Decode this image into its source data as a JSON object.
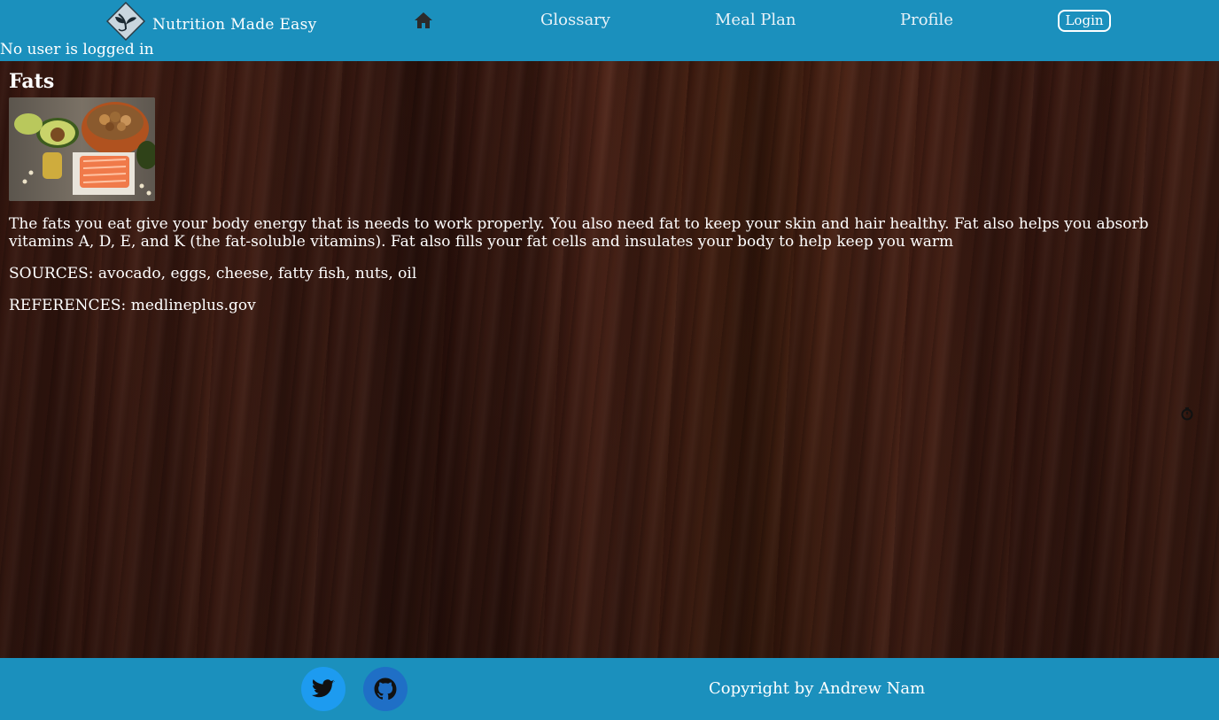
{
  "brand": {
    "name": "Nutrition Made Easy",
    "logo_icon": "leaf-diamond-logo"
  },
  "nav": {
    "home_icon": "home-icon",
    "glossary": "Glossary",
    "meal_plan": "Meal Plan",
    "profile": "Profile",
    "login": "Login"
  },
  "user_status": "No user is logged in",
  "article": {
    "title": "Fats",
    "image_subject": "fat-rich foods: avocado, salmon, nuts, oil",
    "description": "The fats you eat give your body energy that is needs to work properly. You also need fat to keep your skin and hair healthy. Fat also helps you absorb vitamins A, D, E, and K (the fat-soluble vitamins). Fat also fills your fat cells and insulates your body to help keep you warm",
    "sources": "SOURCES: avocado, eggs, cheese, fatty fish, nuts, oil",
    "references": "REFERENCES: medlineplus.gov"
  },
  "footer": {
    "twitter_icon": "twitter-icon",
    "github_icon": "github-icon",
    "copyright": "Copyright by Andrew Nam"
  },
  "colors": {
    "navbar": "#1b90bd",
    "twitter": "#1d9bf0",
    "github": "#1f6fc6",
    "text": "#ffffff"
  }
}
